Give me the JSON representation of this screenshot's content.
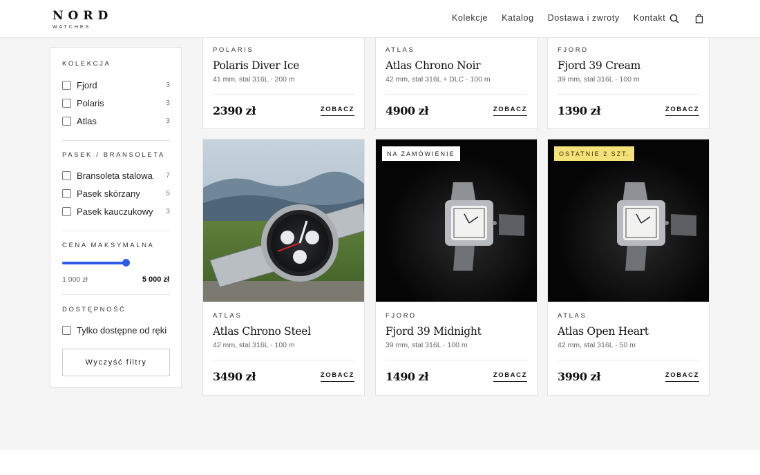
{
  "logo": {
    "main": "NORD",
    "sub": "WATCHES"
  },
  "nav": {
    "items": [
      "Kolekcje",
      "Katalog",
      "Dostawa i zwroty",
      "Kontakt"
    ]
  },
  "sidebar": {
    "collection_title": "KOLEKCJA",
    "collection": [
      {
        "label": "Fjord",
        "count": "3"
      },
      {
        "label": "Polaris",
        "count": "3"
      },
      {
        "label": "Atlas",
        "count": "3"
      }
    ],
    "strap_title": "PASEK / BRANSOLETA",
    "strap": [
      {
        "label": "Bransoleta stalowa",
        "count": "7"
      },
      {
        "label": "Pasek skórzany",
        "count": "5"
      },
      {
        "label": "Pasek kauczukowy",
        "count": "3"
      }
    ],
    "price_title": "CENA MAKSYMALNA",
    "price_min": "1 000 zł",
    "price_max": "5 000 zł",
    "availability_title": "DOSTĘPNOŚĆ",
    "availability_label": "Tylko dostępne od ręki",
    "clear_label": "Wyczyść filtry"
  },
  "products": [
    {
      "brand": "POLARIS",
      "name": "Polaris Diver Ice",
      "spec": "41 mm, stal 316L · 200 m",
      "price": "2390 zł",
      "cta": "ZOBACZ"
    },
    {
      "brand": "ATLAS",
      "name": "Atlas Chrono Noir",
      "spec": "42 mm, stal 316L + DLC · 100 m",
      "price": "4900 zł",
      "cta": "ZOBACZ"
    },
    {
      "brand": "FJORD",
      "name": "Fjord 39 Cream",
      "spec": "39 mm, stal 316L · 100 m",
      "price": "1390 zł",
      "cta": "ZOBACZ"
    },
    {
      "brand": "ATLAS",
      "name": "Atlas Chrono Steel",
      "spec": "42 mm, stal 316L · 100 m",
      "price": "3490 zł",
      "cta": "ZOBACZ"
    },
    {
      "brand": "FJORD",
      "name": "Fjord 39 Midnight",
      "spec": "39 mm, stal 316L · 100 m",
      "price": "1490 zł",
      "cta": "ZOBACZ",
      "badge": "NA ZAMÓWIENIE"
    },
    {
      "brand": "ATLAS",
      "name": "Atlas Open Heart",
      "spec": "42 mm, stal 316L · 50 m",
      "price": "3990 zł",
      "cta": "ZOBACZ",
      "badge": "OSTATNIE 2 SZT."
    }
  ],
  "colors": {
    "accent": "#2e5be6",
    "badge_light": "#ffffff",
    "badge_yellow": "#f3e27a"
  },
  "icons": {
    "search": "search-icon",
    "bag": "shopping-bag-icon"
  }
}
